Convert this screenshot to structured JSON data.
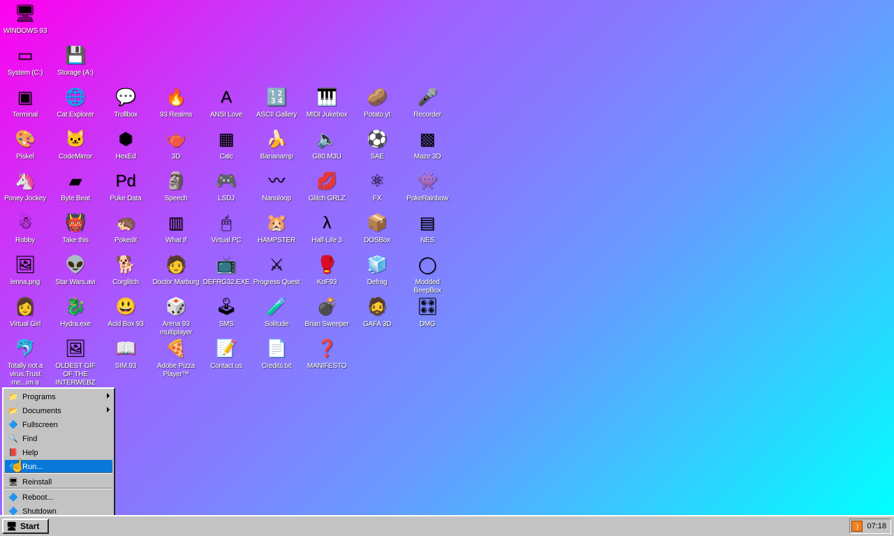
{
  "desktop": {
    "icons": [
      {
        "label": "WINDOWS 93",
        "glyph": "🖥"
      },
      {
        "label": "System (C:)",
        "glyph": "▭"
      },
      {
        "label": "Storage (A:)",
        "glyph": "💾"
      },
      {
        "label": "Terminal",
        "glyph": "▣"
      },
      {
        "label": "Cat Explorer",
        "glyph": "🌐"
      },
      {
        "label": "Trollbox",
        "glyph": "💬"
      },
      {
        "label": "93 Realms",
        "glyph": "🔥"
      },
      {
        "label": "ANSI Love",
        "glyph": "A"
      },
      {
        "label": "ASCII Gallery",
        "glyph": "🔢"
      },
      {
        "label": "MIDI Jukebox",
        "glyph": "🎹"
      },
      {
        "label": "Potato.yt",
        "glyph": "🥔"
      },
      {
        "label": "Recorder",
        "glyph": "🎤"
      },
      {
        "label": "Piskel",
        "glyph": "🎨"
      },
      {
        "label": "CodeMirror",
        "glyph": "🐱"
      },
      {
        "label": "HexEd",
        "glyph": "⬢"
      },
      {
        "label": "3D",
        "glyph": "🫖"
      },
      {
        "label": "Calc",
        "glyph": "▦"
      },
      {
        "label": "Bananamp",
        "glyph": "🍌"
      },
      {
        "label": "G80.M3U",
        "glyph": "🔈"
      },
      {
        "label": "SAE",
        "glyph": "⚽"
      },
      {
        "label": "Maze 3D",
        "glyph": "▩"
      },
      {
        "label": "Poney Jockey",
        "glyph": "🦄"
      },
      {
        "label": "Byte Beat",
        "glyph": "▰"
      },
      {
        "label": "Puke Data",
        "glyph": "Pd"
      },
      {
        "label": "Speech",
        "glyph": "🗿"
      },
      {
        "label": "LSDJ",
        "glyph": "🎮"
      },
      {
        "label": "Nanoloop",
        "glyph": "〰"
      },
      {
        "label": "Glitch GRLZ",
        "glyph": "💋"
      },
      {
        "label": "FX",
        "glyph": "⚛"
      },
      {
        "label": "PokeRainbow",
        "glyph": "👾"
      },
      {
        "label": "Robby",
        "glyph": "☃"
      },
      {
        "label": "Take this",
        "glyph": "👹"
      },
      {
        "label": "Pokedit",
        "glyph": "🦔"
      },
      {
        "label": "What If",
        "glyph": "▥"
      },
      {
        "label": "Virtual PC",
        "glyph": "🖱"
      },
      {
        "label": "HAMPSTER",
        "glyph": "🐹"
      },
      {
        "label": "Half-Life 3",
        "glyph": "λ"
      },
      {
        "label": "DOSBox",
        "glyph": "📦"
      },
      {
        "label": "NES",
        "glyph": "▤"
      },
      {
        "label": "lenna.png",
        "glyph": "🖼"
      },
      {
        "label": "Star Wars.avi",
        "glyph": "👽"
      },
      {
        "label": "Corglitch",
        "glyph": "🐕"
      },
      {
        "label": "Doctor Marburg",
        "glyph": "🧑"
      },
      {
        "label": "DEFRG32.EXE",
        "glyph": "📺"
      },
      {
        "label": "Progress Quest",
        "glyph": "⚔"
      },
      {
        "label": "KoF93",
        "glyph": "🥊"
      },
      {
        "label": "Defrag",
        "glyph": "🧊"
      },
      {
        "label": "Modded BeepBox",
        "glyph": "◯"
      },
      {
        "label": "Virtual Girl",
        "glyph": "👩"
      },
      {
        "label": "Hydra.exe",
        "glyph": "🐉"
      },
      {
        "label": "Acid Box 93",
        "glyph": "😃"
      },
      {
        "label": "Arena 93 multiplayer",
        "glyph": "🎲"
      },
      {
        "label": "SMS",
        "glyph": "🕹"
      },
      {
        "label": "Solitude",
        "glyph": "🧪"
      },
      {
        "label": "Brian Sweeper",
        "glyph": "💣"
      },
      {
        "label": "GAFA 3D",
        "glyph": "🧔"
      },
      {
        "label": "DMG",
        "glyph": "🎛"
      },
      {
        "label": "Totally not a virus.Trust me...im a",
        "glyph": "🐬"
      },
      {
        "label": "OLDEST GIF OF THE INTERWEBZ",
        "glyph": "🖼"
      },
      {
        "label": "SIM.93",
        "glyph": "📖"
      },
      {
        "label": "Adobe Pizza Player™",
        "glyph": "🍕"
      },
      {
        "label": "Contact us",
        "glyph": "📝"
      },
      {
        "label": "Credits.txt",
        "glyph": "📄"
      },
      {
        "label": "MANIFESTO",
        "glyph": "❓"
      }
    ]
  },
  "start_menu": {
    "items": [
      {
        "label": "Programs",
        "icon": "📁",
        "submenu": true,
        "selected": false
      },
      {
        "label": "Documents",
        "icon": "📂",
        "submenu": true,
        "selected": false
      },
      {
        "label": "Fullscreen",
        "icon": "🔷",
        "submenu": false,
        "selected": false
      },
      {
        "label": "Find",
        "icon": "🔍",
        "submenu": false,
        "selected": false
      },
      {
        "label": "Help",
        "icon": "📕",
        "submenu": false,
        "selected": false
      },
      {
        "label": "Run...",
        "icon": "🔷",
        "submenu": false,
        "selected": true
      },
      {
        "label": "Reinstall",
        "icon": "🖥",
        "submenu": false,
        "selected": false
      },
      {
        "label": "Reboot...",
        "icon": "🔷",
        "submenu": false,
        "selected": false
      },
      {
        "label": "Shutdown",
        "icon": "🔷",
        "submenu": false,
        "selected": false
      }
    ]
  },
  "taskbar": {
    "start_label": "Start",
    "start_icon": "🖥",
    "rss_icon": "rss-icon",
    "clock": "07:18"
  },
  "colors": {
    "selection": "#0a78d8",
    "taskbar": "#c3c3c3"
  }
}
